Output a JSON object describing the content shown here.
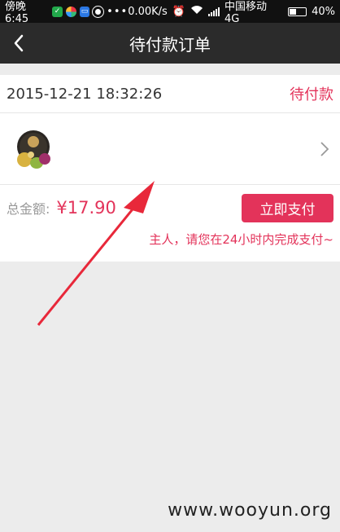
{
  "status_bar": {
    "time": "傍晚6:45",
    "network_speed": "0.00K/s",
    "carrier": "中国移动 4G",
    "battery": "40%"
  },
  "nav": {
    "title": "待付款订单",
    "back_icon": "chevron-left-icon"
  },
  "order": {
    "datetime": "2015-12-21 18:32:26",
    "status": "待付款",
    "product_thumbnail": "product-thumbnail",
    "total_label": "总金额:",
    "total_value": "¥17.90",
    "pay_button_label": "立即支付",
    "reminder": "主人，请您在24小时内完成支付~"
  },
  "watermark": "www.wooyun.org",
  "colors": {
    "accent": "#e3335a",
    "nav_bg": "#2b2b2b",
    "annotation_arrow": "#e8283a"
  }
}
